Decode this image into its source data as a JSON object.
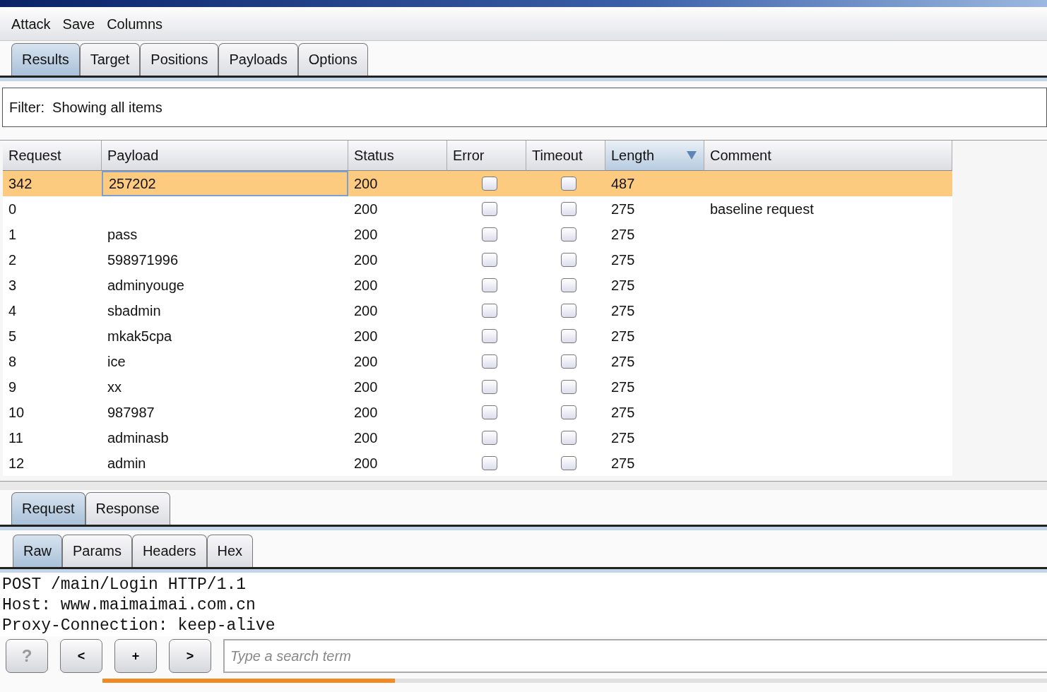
{
  "menu": [
    "Attack",
    "Save",
    "Columns"
  ],
  "tabs": [
    {
      "label": "Results",
      "selected": true
    },
    {
      "label": "Target",
      "selected": false
    },
    {
      "label": "Positions",
      "selected": false
    },
    {
      "label": "Payloads",
      "selected": false
    },
    {
      "label": "Options",
      "selected": false
    }
  ],
  "filter": "Filter:  Showing all items",
  "table": {
    "columns": [
      {
        "label": "Request",
        "sorted": false
      },
      {
        "label": "Payload",
        "sorted": false
      },
      {
        "label": "Status",
        "sorted": false
      },
      {
        "label": "Error",
        "sorted": false
      },
      {
        "label": "Timeout",
        "sorted": false
      },
      {
        "label": "Length",
        "sorted": true
      },
      {
        "label": "Comment",
        "sorted": false
      }
    ],
    "rows": [
      {
        "request": "342",
        "payload": "257202",
        "status": "200",
        "error": false,
        "timeout": false,
        "length": "487",
        "comment": "",
        "selected": true
      },
      {
        "request": "0",
        "payload": "",
        "status": "200",
        "error": false,
        "timeout": false,
        "length": "275",
        "comment": "baseline request",
        "selected": false
      },
      {
        "request": "1",
        "payload": "pass",
        "status": "200",
        "error": false,
        "timeout": false,
        "length": "275",
        "comment": "",
        "selected": false
      },
      {
        "request": "2",
        "payload": "598971996",
        "status": "200",
        "error": false,
        "timeout": false,
        "length": "275",
        "comment": "",
        "selected": false
      },
      {
        "request": "3",
        "payload": "adminyouge",
        "status": "200",
        "error": false,
        "timeout": false,
        "length": "275",
        "comment": "",
        "selected": false
      },
      {
        "request": "4",
        "payload": "sbadmin",
        "status": "200",
        "error": false,
        "timeout": false,
        "length": "275",
        "comment": "",
        "selected": false
      },
      {
        "request": "5",
        "payload": "mkak5cpa",
        "status": "200",
        "error": false,
        "timeout": false,
        "length": "275",
        "comment": "",
        "selected": false
      },
      {
        "request": "8",
        "payload": "ice",
        "status": "200",
        "error": false,
        "timeout": false,
        "length": "275",
        "comment": "",
        "selected": false
      },
      {
        "request": "9",
        "payload": "xx",
        "status": "200",
        "error": false,
        "timeout": false,
        "length": "275",
        "comment": "",
        "selected": false
      },
      {
        "request": "10",
        "payload": "987987",
        "status": "200",
        "error": false,
        "timeout": false,
        "length": "275",
        "comment": "",
        "selected": false
      },
      {
        "request": "11",
        "payload": "adminasb",
        "status": "200",
        "error": false,
        "timeout": false,
        "length": "275",
        "comment": "",
        "selected": false
      },
      {
        "request": "12",
        "payload": "admin",
        "status": "200",
        "error": false,
        "timeout": false,
        "length": "275",
        "comment": "",
        "selected": false
      }
    ]
  },
  "message_tabs": [
    {
      "label": "Request",
      "selected": true
    },
    {
      "label": "Response",
      "selected": false
    }
  ],
  "view_tabs": [
    {
      "label": "Raw",
      "selected": true
    },
    {
      "label": "Params",
      "selected": false
    },
    {
      "label": "Headers",
      "selected": false
    },
    {
      "label": "Hex",
      "selected": false
    }
  ],
  "raw_lines": [
    "POST /main/Login HTTP/1.1",
    "Host: www.maimaimai.com.cn",
    "Proxy-Connection: keep-alive"
  ],
  "search_buttons": [
    {
      "label": "?",
      "disabled": true
    },
    {
      "label": "<",
      "disabled": false
    },
    {
      "label": "+",
      "disabled": false
    },
    {
      "label": ">",
      "disabled": false
    }
  ],
  "search": {
    "placeholder": "Type a search term"
  },
  "progress": {
    "level": 0.31
  }
}
